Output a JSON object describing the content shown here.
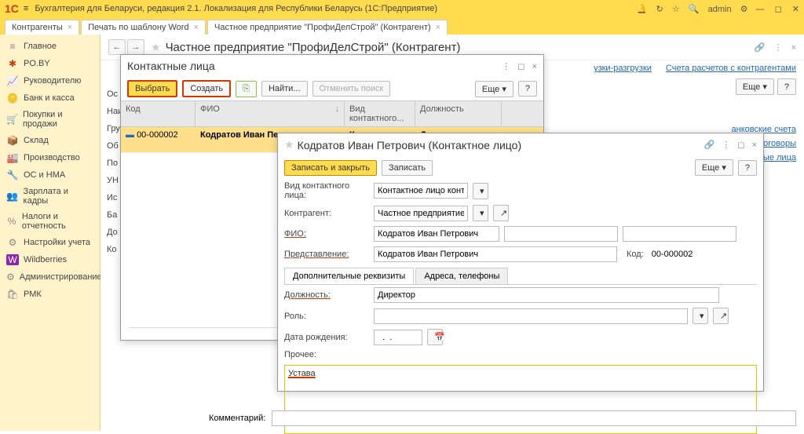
{
  "app": {
    "title": "Бухгалтерия для Беларуси, редакция 2.1. Локализация для Республики Беларусь  (1С:Предприятие)",
    "user": "admin"
  },
  "tabs": [
    {
      "label": "Контрагенты"
    },
    {
      "label": "Печать по шаблону Word"
    },
    {
      "label": "Частное предприятие \"ПрофиДелСтрой\" (Контрагент)"
    }
  ],
  "sidebar": {
    "items": [
      {
        "icon": "≡",
        "label": "Главное"
      },
      {
        "icon": "✱",
        "label": "PO.BY"
      },
      {
        "icon": "📈",
        "label": "Руководителю"
      },
      {
        "icon": "🪙",
        "label": "Банк и касса"
      },
      {
        "icon": "🛒",
        "label": "Покупки и продажи"
      },
      {
        "icon": "📦",
        "label": "Склад"
      },
      {
        "icon": "🏭",
        "label": "Производство"
      },
      {
        "icon": "🔧",
        "label": "ОС и НМА"
      },
      {
        "icon": "👥",
        "label": "Зарплата и кадры"
      },
      {
        "icon": "%",
        "label": "Налоги и отчетность"
      },
      {
        "icon": "⚙",
        "label": "Настройки учета"
      },
      {
        "icon": "W",
        "label": "Wildberries"
      },
      {
        "icon": "⚙",
        "label": "Администрирование"
      },
      {
        "icon": "🛍",
        "label": "РМК"
      }
    ]
  },
  "page": {
    "title": "Частное предприятие \"ПрофиДелСтрой\" (Контрагент)",
    "more": "Еще",
    "links": {
      "l1": "узки-разгрузки",
      "l2": "Счета расчетов с контрагентами"
    },
    "side_links": {
      "a": "анковские счета",
      "b": "оговоры",
      "c": "онтактные лица"
    },
    "left_labels": {
      "a": "Ос",
      "b": "Наи",
      "c": "Гру",
      "d": "Об",
      "e": "По",
      "f": "УН",
      "g": "Ис",
      "h": "Ба",
      "i": "До",
      "j": "Ко"
    },
    "comment_label": "Комментарий:"
  },
  "dlg1": {
    "title": "Контактные лица",
    "btn_select": "Выбрать",
    "btn_create": "Создать",
    "btn_find": "Найти...",
    "btn_cancel": "Отменить поиск",
    "more": "Еще",
    "headers": {
      "code": "Код",
      "fio": "ФИО",
      "type": "Вид контактного...",
      "pos": "Должность"
    },
    "row": {
      "code": "00-000002",
      "fio": "Кодратов Иван Петрович",
      "type": "Контактное ли...",
      "pos": "Директор"
    }
  },
  "dlg2": {
    "title": "Кодратов Иван Петрович (Контактное лицо)",
    "btn_save_close": "Записать и закрыть",
    "btn_save": "Записать",
    "more": "Еще",
    "lbl_type": "Вид контактного лица:",
    "val_type": "Контактное лицо контраген",
    "lbl_kontr": "Контрагент:",
    "val_kontr": "Частное предприятие \"",
    "lbl_fio": "ФИО:",
    "val_fio": "Кодратов Иван Петрович",
    "lbl_repr": "Представление:",
    "val_repr": "Кодратов Иван Петрович",
    "lbl_code": "Код:",
    "val_code": "00-000002",
    "tabs": {
      "a": "Дополнительные реквизиты",
      "b": "Адреса, телефоны"
    },
    "lbl_pos": "Должность:",
    "val_pos": "Директор",
    "lbl_role": "Роль:",
    "lbl_birth": "Дата рождения:",
    "val_birth": "  .  .",
    "lbl_other": "Прочее:",
    "val_other": "Устава"
  }
}
